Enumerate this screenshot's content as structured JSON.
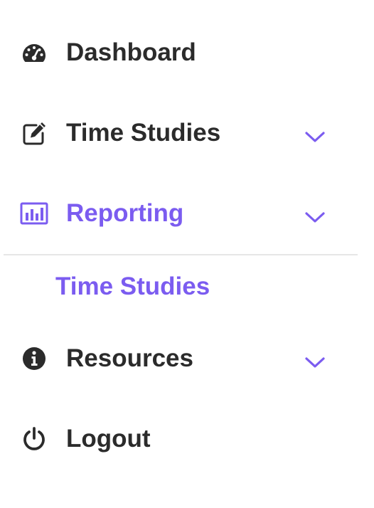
{
  "nav": {
    "items": [
      {
        "label": "Dashboard",
        "icon": "dashboard-icon"
      },
      {
        "label": "Time Studies",
        "icon": "edit-icon",
        "has_chevron": true
      },
      {
        "label": "Reporting",
        "icon": "bar-chart-icon",
        "has_chevron": true,
        "active": true
      },
      {
        "label": "Resources",
        "icon": "info-icon",
        "has_chevron": true
      },
      {
        "label": "Logout",
        "icon": "power-icon"
      }
    ],
    "reporting_submenu": [
      {
        "label": "Time Studies"
      }
    ]
  },
  "colors": {
    "accent": "#7b5cf0",
    "text": "#2b2b2b",
    "divider": "#e6e6e6"
  }
}
